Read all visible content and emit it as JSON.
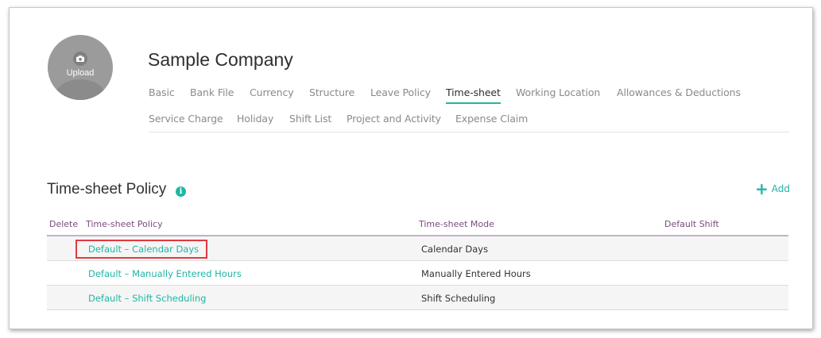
{
  "company": {
    "name": "Sample Company",
    "upload_label": "Upload"
  },
  "tabs": [
    {
      "label": "Basic"
    },
    {
      "label": "Bank File"
    },
    {
      "label": "Currency"
    },
    {
      "label": "Structure"
    },
    {
      "label": "Leave Policy"
    },
    {
      "label": "Time-sheet",
      "active": true
    },
    {
      "label": "Working Location"
    },
    {
      "label": "Allowances & Deductions"
    },
    {
      "label": "Service Charge"
    },
    {
      "label": "Holiday"
    },
    {
      "label": "Shift List"
    },
    {
      "label": "Project and Activity"
    },
    {
      "label": "Expense Claim"
    }
  ],
  "section": {
    "title": "Time-sheet Policy",
    "info_glyph": "i",
    "add_label": "Add",
    "add_glyph": "+"
  },
  "table": {
    "headers": {
      "delete": "Delete",
      "policy": "Time-sheet Policy",
      "mode": "Time-sheet Mode",
      "shift": "Default Shift"
    },
    "rows": [
      {
        "policy": "Default – Calendar Days",
        "mode": "Calendar Days",
        "shift": ""
      },
      {
        "policy": "Default – Manually Entered Hours",
        "mode": "Manually Entered Hours",
        "shift": ""
      },
      {
        "policy": "Default – Shift Scheduling",
        "mode": "Shift Scheduling",
        "shift": ""
      }
    ]
  },
  "colors": {
    "accent": "#1fb6a4",
    "header_text": "#7a4c7d",
    "highlight": "#e0393e"
  }
}
